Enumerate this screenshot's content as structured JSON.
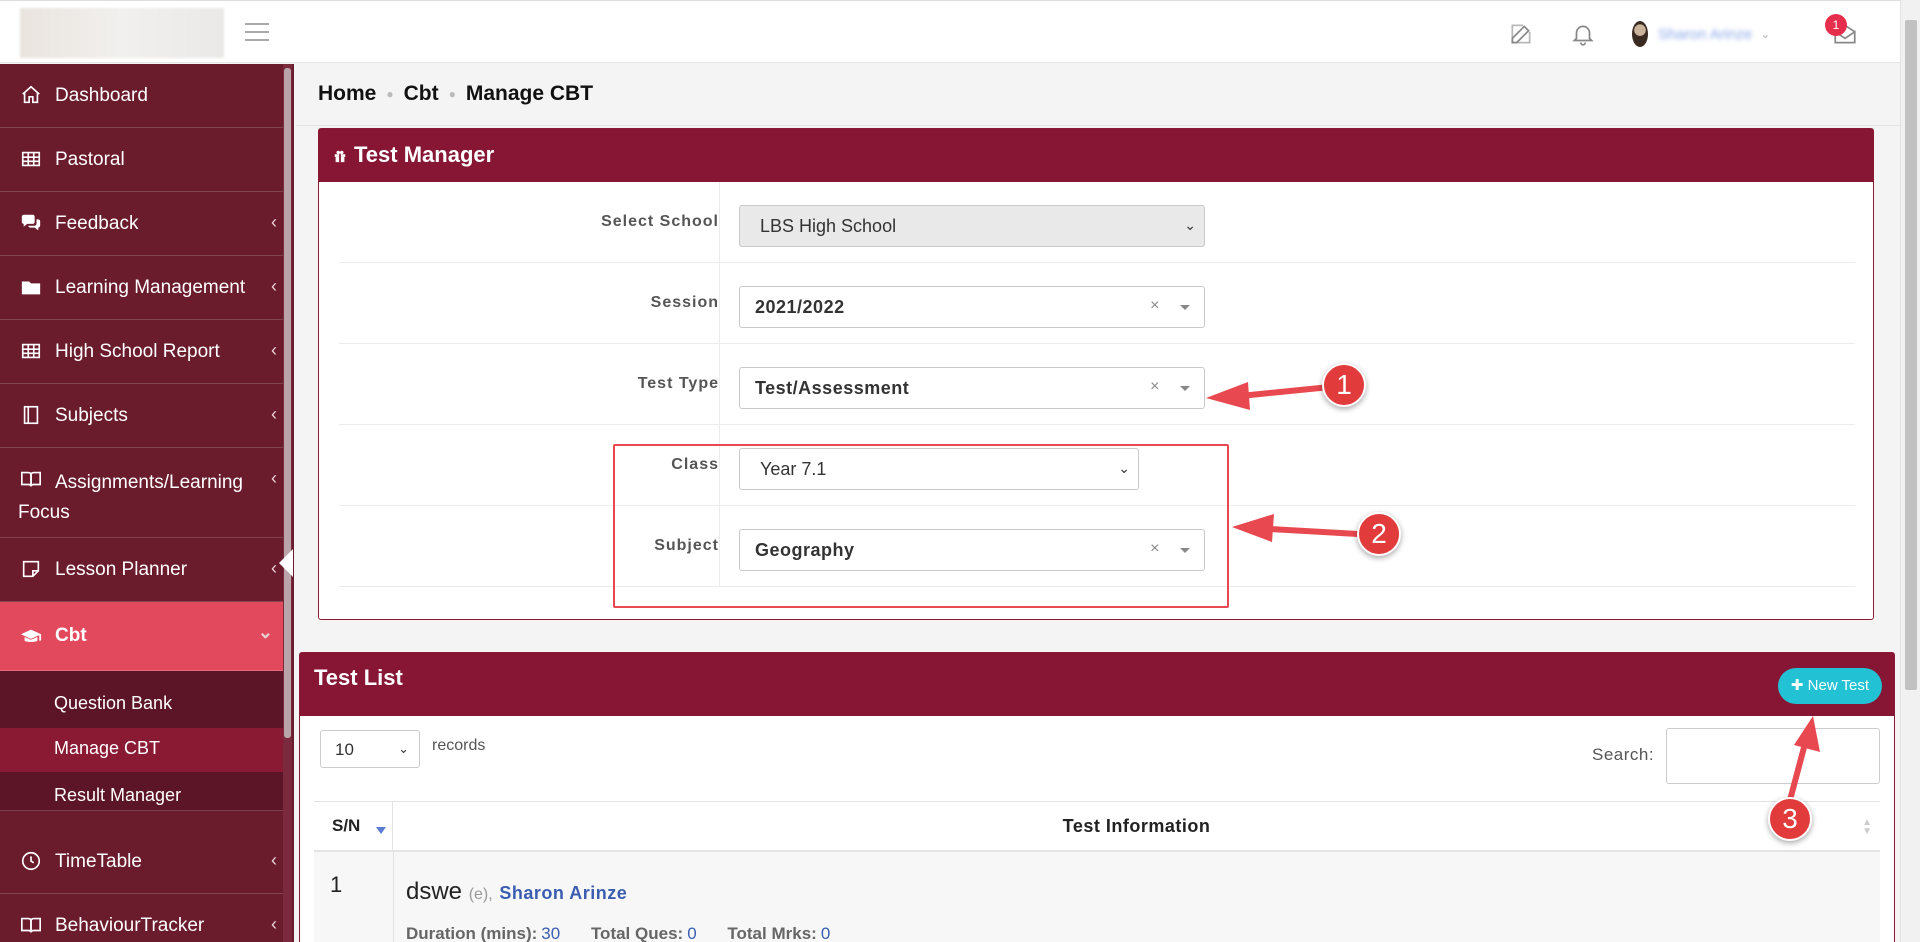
{
  "topbar": {
    "user_name": "Sharon Arinze",
    "mail_count": "1"
  },
  "sidebar": {
    "items": [
      {
        "label": "Dashboard"
      },
      {
        "label": "Pastoral"
      },
      {
        "label": "Feedback"
      },
      {
        "label": "Learning Management"
      },
      {
        "label": "High School Report"
      },
      {
        "label": "Subjects"
      },
      {
        "label": "Assignments/Learning Focus"
      },
      {
        "label": "Lesson Planner"
      },
      {
        "label": "Cbt"
      },
      {
        "label": "TimeTable"
      },
      {
        "label": "BehaviourTracker"
      }
    ],
    "sub_items": [
      {
        "label": "Question Bank"
      },
      {
        "label": "Manage CBT"
      },
      {
        "label": "Result Manager"
      }
    ]
  },
  "breadcrumb": {
    "home": "Home",
    "cbt": "Cbt",
    "current": "Manage CBT"
  },
  "test_manager": {
    "title": "Test Manager",
    "school_label": "Select School",
    "school_value": "LBS High School",
    "session_label": "Session",
    "session_value": "2021/2022",
    "test_type_label": "Test Type",
    "test_type_value": "Test/Assessment",
    "class_label": "Class",
    "class_value": "Year 7.1",
    "subject_label": "Subject",
    "subject_value": "Geography",
    "clear_symbol": "×"
  },
  "annotations": {
    "one": "1",
    "two": "2",
    "three": "3"
  },
  "test_list": {
    "title": "Test List",
    "new_test_label": "New Test",
    "page_length": "10",
    "records_label": "records",
    "search_label": "Search:",
    "col_sn": "S/N",
    "col_info": "Test Information",
    "rows": [
      {
        "sn": "1",
        "name": "dswe",
        "code": "(e),",
        "author": "Sharon Arinze",
        "duration_label": "Duration (mins):",
        "duration": "30",
        "ques_label": "Total Ques:",
        "ques": "0",
        "marks_label": "Total Mrks:",
        "marks": "0"
      }
    ]
  },
  "colors": {
    "sidebar_bg": "#6a1b2c",
    "active_item": "#e2495c",
    "card_header": "#861634",
    "new_test_btn": "#22c1d4",
    "annotation_red": "#e23b3b",
    "link_blue": "#3a5db0"
  }
}
